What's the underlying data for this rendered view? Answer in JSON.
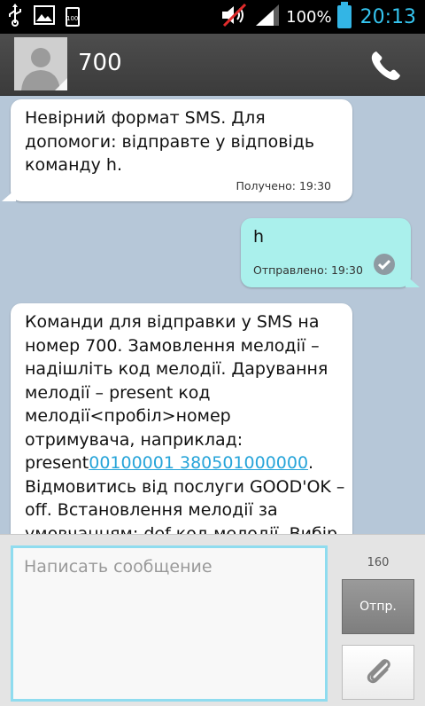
{
  "status_bar": {
    "battery_mini_label": "100",
    "battery_percent": "100%",
    "time": "20:13",
    "icons": [
      "usb-icon",
      "image-icon",
      "battery-small-icon",
      "mute-icon",
      "signal-icon",
      "battery-icon"
    ]
  },
  "header": {
    "contact_name": "700"
  },
  "messages": [
    {
      "direction": "incoming",
      "text": "Невірний формат SMS. Для допомоги: відправте у відповідь команду h.",
      "meta": "Получено: 19:30"
    },
    {
      "direction": "outgoing",
      "text": "h",
      "meta": "Отправлено: 19:30"
    },
    {
      "direction": "incoming",
      "text_before_link": "Команди для відправки у SMS на номер 700. Замовлення мелодії – надішліть код мелодії. Дарування мелодії – present код мелодії<пробіл>номер отримувача, наприклад: present",
      "link": "00100001 380501000000",
      "text_after_link": ". Відмовитись від послуги GOOD'OK – off. Встановлення мелодії за умовчанням: def код мелодії. Вибір"
    }
  ],
  "compose": {
    "placeholder": "Написать сообщение",
    "counter": "160",
    "send_label": "Отпр."
  },
  "colors": {
    "conversation_bg": "#b6c7d8",
    "incoming_bubble": "#ffffff",
    "outgoing_bubble": "#aaf0ec",
    "accent": "#35c5f0",
    "link": "#26a4d9"
  }
}
